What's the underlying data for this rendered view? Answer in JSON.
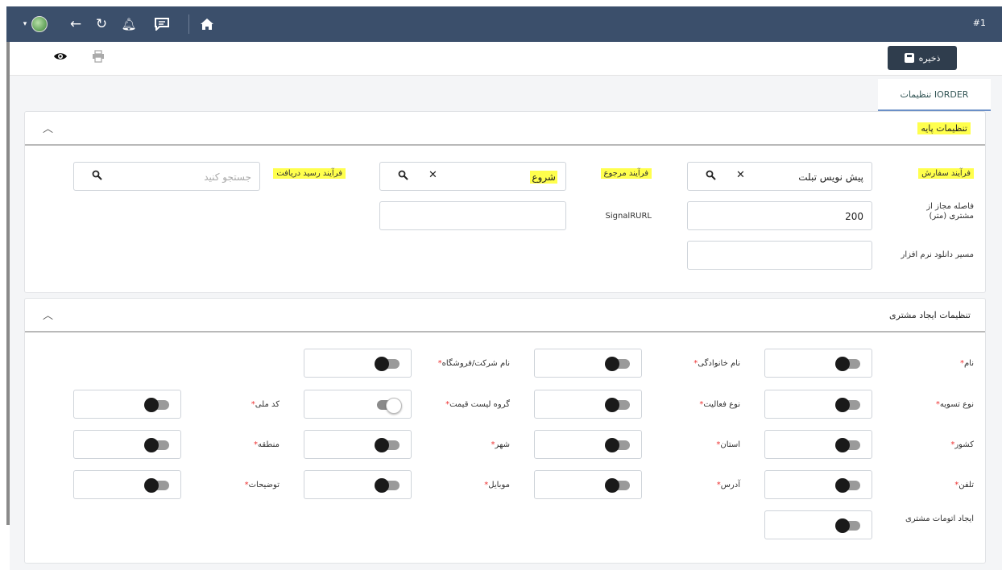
{
  "topbar": {
    "window_number": "#1"
  },
  "toolbar": {
    "save_label": "ذخیره"
  },
  "tab": {
    "label": "تنظیمات IORDER"
  },
  "base_settings": {
    "title": "تنظیمات پایه",
    "order_process_label": "فرآیند سفارش",
    "order_process_value": "پیش نویس تبلت",
    "return_process_label": "فرآیند مرجوع",
    "return_process_value": "شروع",
    "receipt_process_label": "فرآیند رسید دریافت",
    "receipt_process_placeholder": "جستجو کنید",
    "distance_label": "فاصله مجاز از مشتری (متر)",
    "distance_value": "200",
    "signalr_label": "SignalRURL",
    "signalr_value": "",
    "download_path_label": "مسیر دانلود نرم افزار",
    "download_path_value": ""
  },
  "customer_settings": {
    "title": "تنظیمات ایجاد مشتری",
    "fields": {
      "name": {
        "label": "نام",
        "required": true,
        "enabled": false
      },
      "family_name": {
        "label": "نام خانوادگی",
        "required": true,
        "enabled": false
      },
      "company_name": {
        "label": "نام شرکت/فروشگاه",
        "required": true,
        "enabled": false
      },
      "settlement_type": {
        "label": "نوع تسویه",
        "required": true,
        "enabled": false
      },
      "activity_type": {
        "label": "نوع فعالیت",
        "required": true,
        "enabled": false
      },
      "price_list_group": {
        "label": "گروه لیست قیمت",
        "required": true,
        "enabled": true
      },
      "national_code": {
        "label": "کد ملی",
        "required": true,
        "enabled": false
      },
      "country": {
        "label": "کشور",
        "required": true,
        "enabled": false
      },
      "province": {
        "label": "استان",
        "required": true,
        "enabled": false
      },
      "city": {
        "label": "شهر",
        "required": true,
        "enabled": false
      },
      "region": {
        "label": "منطقه",
        "required": true,
        "enabled": false
      },
      "phone": {
        "label": "تلفن",
        "required": true,
        "enabled": false
      },
      "address": {
        "label": "آدرس",
        "required": true,
        "enabled": false
      },
      "mobile": {
        "label": "موبایل",
        "required": true,
        "enabled": false
      },
      "description": {
        "label": "توضیحات",
        "required": true,
        "enabled": false
      },
      "auto_create_customer": {
        "label": "ایجاد اتومات مشتری",
        "required": false,
        "enabled": false
      }
    }
  },
  "icons": {
    "save": "floppy-disk-icon",
    "view": "eye-icon",
    "print": "printer-icon",
    "home": "home-icon",
    "back": "arrow-left-icon",
    "refresh": "refresh-icon",
    "notify": "bell-icon",
    "message": "chat-icon"
  }
}
